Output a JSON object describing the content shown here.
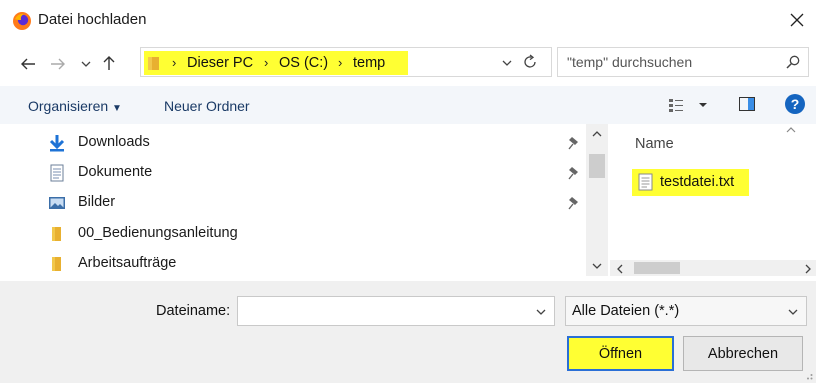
{
  "window": {
    "title": "Datei hochladen"
  },
  "address": {
    "crumbs": [
      "Dieser PC",
      "OS (C:)",
      "temp"
    ]
  },
  "search": {
    "placeholder": "\"temp\" durchsuchen"
  },
  "toolbar": {
    "organize": "Organisieren",
    "new_folder": "Neuer Ordner"
  },
  "nav_pane": {
    "items": [
      {
        "label": "Downloads",
        "icon": "download-arrow-icon",
        "pinned": true
      },
      {
        "label": "Dokumente",
        "icon": "document-icon",
        "pinned": true
      },
      {
        "label": "Bilder",
        "icon": "pictures-icon",
        "pinned": true
      },
      {
        "label": "00_Bedienungsanleitung",
        "icon": "folder-icon",
        "pinned": false
      },
      {
        "label": "Arbeitsaufträge",
        "icon": "folder-icon",
        "pinned": false
      }
    ]
  },
  "file_pane": {
    "column_name": "Name",
    "files": [
      {
        "name": "testdatei.txt",
        "icon": "text-file-icon"
      }
    ]
  },
  "bottom": {
    "filename_label": "Dateiname:",
    "filename_value": "",
    "filetype_value": "Alle Dateien (*.*)",
    "open_label": "Öffnen",
    "cancel_label": "Abbrechen"
  },
  "colors": {
    "highlight": "#ffff33",
    "accent": "#0078d7",
    "help": "#1565c0"
  }
}
